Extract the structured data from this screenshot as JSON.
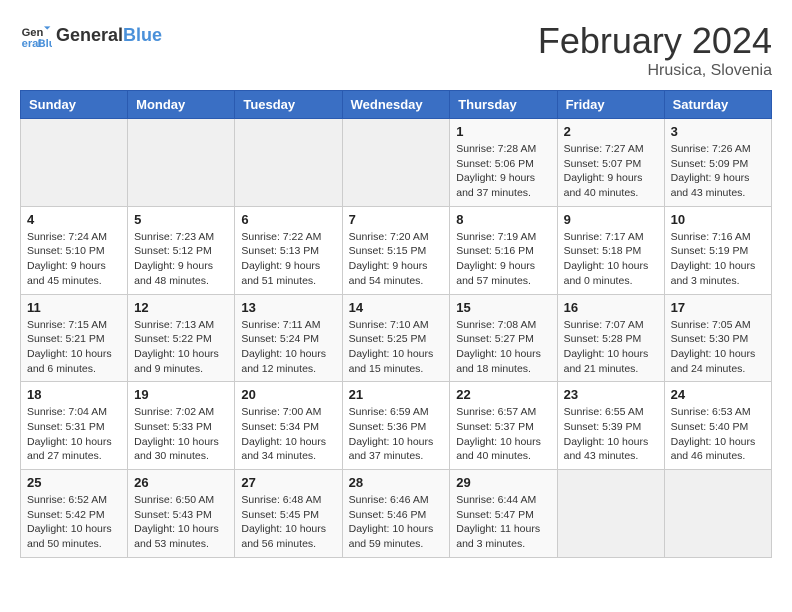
{
  "header": {
    "logo_general": "General",
    "logo_blue": "Blue",
    "main_title": "February 2024",
    "subtitle": "Hrusica, Slovenia"
  },
  "days_of_week": [
    "Sunday",
    "Monday",
    "Tuesday",
    "Wednesday",
    "Thursday",
    "Friday",
    "Saturday"
  ],
  "weeks": [
    [
      {
        "day": "",
        "info": ""
      },
      {
        "day": "",
        "info": ""
      },
      {
        "day": "",
        "info": ""
      },
      {
        "day": "",
        "info": ""
      },
      {
        "day": "1",
        "info": "Sunrise: 7:28 AM\nSunset: 5:06 PM\nDaylight: 9 hours\nand 37 minutes."
      },
      {
        "day": "2",
        "info": "Sunrise: 7:27 AM\nSunset: 5:07 PM\nDaylight: 9 hours\nand 40 minutes."
      },
      {
        "day": "3",
        "info": "Sunrise: 7:26 AM\nSunset: 5:09 PM\nDaylight: 9 hours\nand 43 minutes."
      }
    ],
    [
      {
        "day": "4",
        "info": "Sunrise: 7:24 AM\nSunset: 5:10 PM\nDaylight: 9 hours\nand 45 minutes."
      },
      {
        "day": "5",
        "info": "Sunrise: 7:23 AM\nSunset: 5:12 PM\nDaylight: 9 hours\nand 48 minutes."
      },
      {
        "day": "6",
        "info": "Sunrise: 7:22 AM\nSunset: 5:13 PM\nDaylight: 9 hours\nand 51 minutes."
      },
      {
        "day": "7",
        "info": "Sunrise: 7:20 AM\nSunset: 5:15 PM\nDaylight: 9 hours\nand 54 minutes."
      },
      {
        "day": "8",
        "info": "Sunrise: 7:19 AM\nSunset: 5:16 PM\nDaylight: 9 hours\nand 57 minutes."
      },
      {
        "day": "9",
        "info": "Sunrise: 7:17 AM\nSunset: 5:18 PM\nDaylight: 10 hours\nand 0 minutes."
      },
      {
        "day": "10",
        "info": "Sunrise: 7:16 AM\nSunset: 5:19 PM\nDaylight: 10 hours\nand 3 minutes."
      }
    ],
    [
      {
        "day": "11",
        "info": "Sunrise: 7:15 AM\nSunset: 5:21 PM\nDaylight: 10 hours\nand 6 minutes."
      },
      {
        "day": "12",
        "info": "Sunrise: 7:13 AM\nSunset: 5:22 PM\nDaylight: 10 hours\nand 9 minutes."
      },
      {
        "day": "13",
        "info": "Sunrise: 7:11 AM\nSunset: 5:24 PM\nDaylight: 10 hours\nand 12 minutes."
      },
      {
        "day": "14",
        "info": "Sunrise: 7:10 AM\nSunset: 5:25 PM\nDaylight: 10 hours\nand 15 minutes."
      },
      {
        "day": "15",
        "info": "Sunrise: 7:08 AM\nSunset: 5:27 PM\nDaylight: 10 hours\nand 18 minutes."
      },
      {
        "day": "16",
        "info": "Sunrise: 7:07 AM\nSunset: 5:28 PM\nDaylight: 10 hours\nand 21 minutes."
      },
      {
        "day": "17",
        "info": "Sunrise: 7:05 AM\nSunset: 5:30 PM\nDaylight: 10 hours\nand 24 minutes."
      }
    ],
    [
      {
        "day": "18",
        "info": "Sunrise: 7:04 AM\nSunset: 5:31 PM\nDaylight: 10 hours\nand 27 minutes."
      },
      {
        "day": "19",
        "info": "Sunrise: 7:02 AM\nSunset: 5:33 PM\nDaylight: 10 hours\nand 30 minutes."
      },
      {
        "day": "20",
        "info": "Sunrise: 7:00 AM\nSunset: 5:34 PM\nDaylight: 10 hours\nand 34 minutes."
      },
      {
        "day": "21",
        "info": "Sunrise: 6:59 AM\nSunset: 5:36 PM\nDaylight: 10 hours\nand 37 minutes."
      },
      {
        "day": "22",
        "info": "Sunrise: 6:57 AM\nSunset: 5:37 PM\nDaylight: 10 hours\nand 40 minutes."
      },
      {
        "day": "23",
        "info": "Sunrise: 6:55 AM\nSunset: 5:39 PM\nDaylight: 10 hours\nand 43 minutes."
      },
      {
        "day": "24",
        "info": "Sunrise: 6:53 AM\nSunset: 5:40 PM\nDaylight: 10 hours\nand 46 minutes."
      }
    ],
    [
      {
        "day": "25",
        "info": "Sunrise: 6:52 AM\nSunset: 5:42 PM\nDaylight: 10 hours\nand 50 minutes."
      },
      {
        "day": "26",
        "info": "Sunrise: 6:50 AM\nSunset: 5:43 PM\nDaylight: 10 hours\nand 53 minutes."
      },
      {
        "day": "27",
        "info": "Sunrise: 6:48 AM\nSunset: 5:45 PM\nDaylight: 10 hours\nand 56 minutes."
      },
      {
        "day": "28",
        "info": "Sunrise: 6:46 AM\nSunset: 5:46 PM\nDaylight: 10 hours\nand 59 minutes."
      },
      {
        "day": "29",
        "info": "Sunrise: 6:44 AM\nSunset: 5:47 PM\nDaylight: 11 hours\nand 3 minutes."
      },
      {
        "day": "",
        "info": ""
      },
      {
        "day": "",
        "info": ""
      }
    ]
  ]
}
